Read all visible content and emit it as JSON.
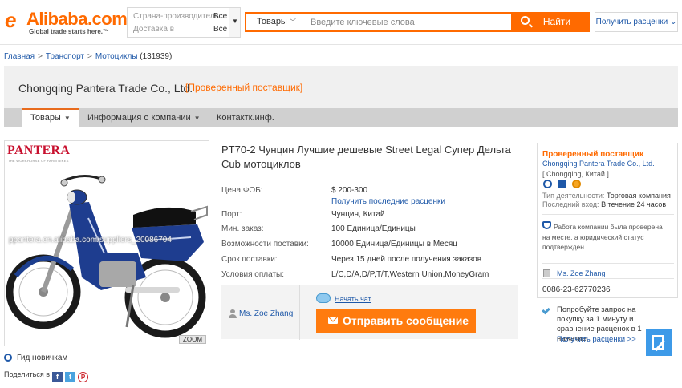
{
  "header": {
    "logo_text": "Alibaba.com",
    "logo_tagline": "Global trade starts here.™",
    "region": {
      "country_label": "Страна-производитель",
      "country_value": "Все",
      "delivery_label": "Доставка в",
      "delivery_value": "Все"
    },
    "search": {
      "category": "Товары",
      "placeholder": "Введите ключевые слова",
      "button_label": "Найти"
    },
    "quote_button": "Получить расценки"
  },
  "breadcrumb": {
    "items": [
      "Главная",
      "Транспорт",
      "Мотоциклы"
    ],
    "count": "(131939)",
    "separator": ">"
  },
  "banner": {
    "company_name": "Chongqing Pantera Trade Co., Ltd.",
    "verified_tag": "[Проверенный поставщик]"
  },
  "nav": {
    "items": [
      {
        "label": "Товары"
      },
      {
        "label": "Информация о компании"
      },
      {
        "label": "Контактк.инф."
      }
    ]
  },
  "product_image": {
    "brand_logo": "PANTERA",
    "brand_subtitle": "THE WORKHORSE OF FARM BIKES",
    "watermark": "ppantera.en.alibaba.com/suppliers_20086704",
    "zoom_label": "ZOOM"
  },
  "guide": "Гид новичкам",
  "share": {
    "label": "Поделиться в",
    "icons": [
      "facebook-icon",
      "twitter-icon",
      "pinterest-icon"
    ]
  },
  "product": {
    "title": "PT70-2 Чунцин Лучшие дешевые Street Legal Супер Дельта Cub мотоциклов",
    "specs": [
      {
        "label": "Цена ФОБ:",
        "value": "$ 200-300",
        "link": "Получить последние расценки"
      },
      {
        "label": "Порт:",
        "value": "Чунцин, Китай"
      },
      {
        "label": "Мин. заказ:",
        "value": "100 Единица/Единицы"
      },
      {
        "label": "Возможности поставки:",
        "value": "10000 Единица/Единицы в Месяц"
      },
      {
        "label": "Срок поставки:",
        "value": "Через 15 дней после получения заказов"
      },
      {
        "label": "Условия оплаты:",
        "value": "L/C,D/A,D/P,T/T,Western Union,MoneyGram"
      }
    ],
    "contact_name": "Ms. Zoe Zhang",
    "chat_label": "Начать чат",
    "send_button": "Отправить сообщение"
  },
  "supplier": {
    "heading": "Проверенный поставщик",
    "name": "Chongqing Pantera Trade Co., Ltd.",
    "location": "[ Chongqing, Китай ]",
    "business_type_label": "Тип деятельности:",
    "business_type_value": "Торговая компания",
    "last_login_label": "Последний вход:",
    "last_login_value": "В течение 24 часов",
    "verification_text": "Работа компании была проверена на месте, а юридический статус подтвержден",
    "contact_person": "Ms. Zoe Zhang",
    "phone": "0086-23-62770236"
  },
  "rfq": {
    "text": "Попробуйте запрос на покупку за 1 минуту и сравнение расценок в 1 нажатие.",
    "link": "Получить расценки >>"
  },
  "colors": {
    "brand_orange": "#ff6a00",
    "link_blue": "#1e58a8",
    "send_button": "#ff7b0e",
    "nav_bar": "#d0d0d0",
    "banner_bg": "#f0f0f0"
  }
}
